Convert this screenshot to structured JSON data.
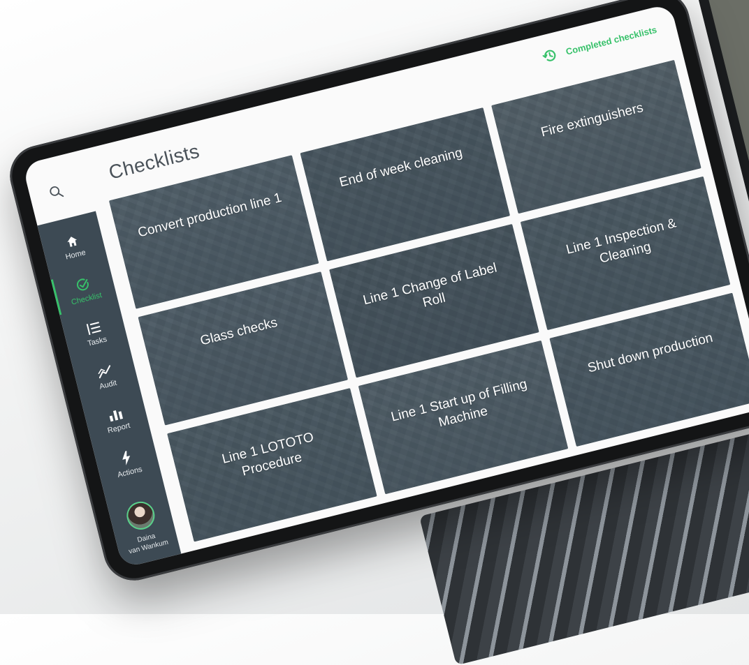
{
  "app": {
    "title": "Checklists",
    "accent_color": "#37c16a",
    "sidebar_color": "#3d4a54"
  },
  "header": {
    "search_icon": "search-icon",
    "completed_link": {
      "label": "Completed checklists",
      "icon": "history-icon"
    }
  },
  "sidebar": {
    "items": [
      {
        "label": "Home",
        "icon": "home-icon",
        "active": false
      },
      {
        "label": "Checklist",
        "icon": "check-circle-icon",
        "active": true
      },
      {
        "label": "Tasks",
        "icon": "list-icon",
        "active": false
      },
      {
        "label": "Audit",
        "icon": "trend-icon",
        "active": false
      },
      {
        "label": "Report",
        "icon": "bar-chart-icon",
        "active": false
      },
      {
        "label": "Actions",
        "icon": "lightning-icon",
        "active": false
      }
    ],
    "user": {
      "first_name": "Daina",
      "last_name": "van Wankum"
    }
  },
  "checklists": [
    {
      "title": "Convert production line 1"
    },
    {
      "title": "End of week cleaning"
    },
    {
      "title": "Fire extinguishers"
    },
    {
      "title": "Glass checks"
    },
    {
      "title": "Line 1 Change of Label Roll"
    },
    {
      "title": "Line 1 Inspection & Cleaning"
    },
    {
      "title": "Line 1 LOTOTO Procedure"
    },
    {
      "title": "Line 1 Start up of Filling Machine"
    },
    {
      "title": "Shut down production"
    }
  ]
}
